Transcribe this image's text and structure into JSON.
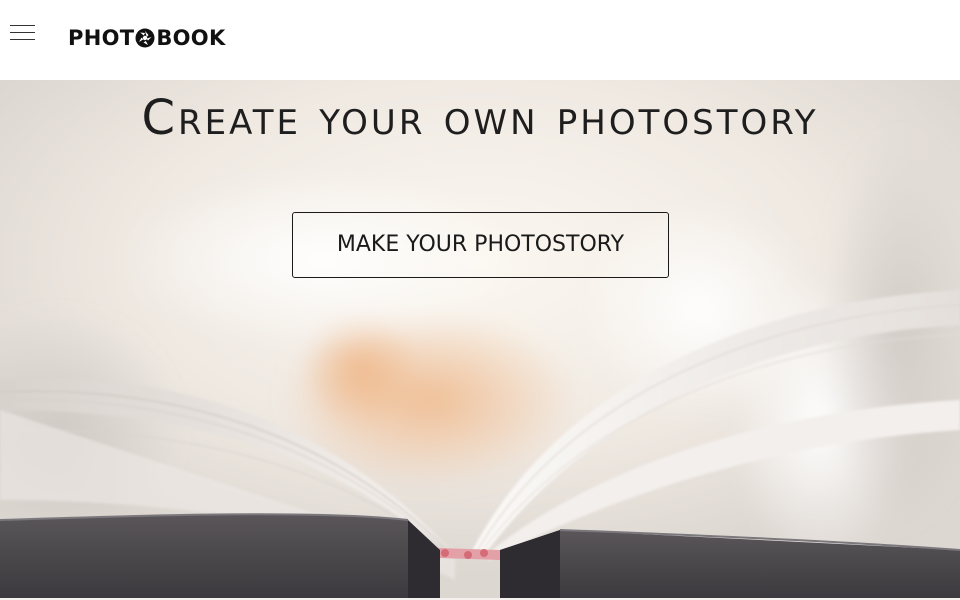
{
  "header": {
    "menu_icon": "hamburger-menu-icon",
    "logo": {
      "text_before": "PHOT",
      "icon": "camera-shutter-icon",
      "text_after": "BOOK"
    }
  },
  "hero": {
    "title": "Create your own photostory",
    "cta_label": "MAKE YOUR PHOTOSTORY"
  },
  "colors": {
    "text": "#1e1e1e",
    "header_bg": "#ffffff",
    "hero_bg": "#efeae5",
    "page_edge": "#e3a0a6",
    "cover": "#4a474b"
  }
}
